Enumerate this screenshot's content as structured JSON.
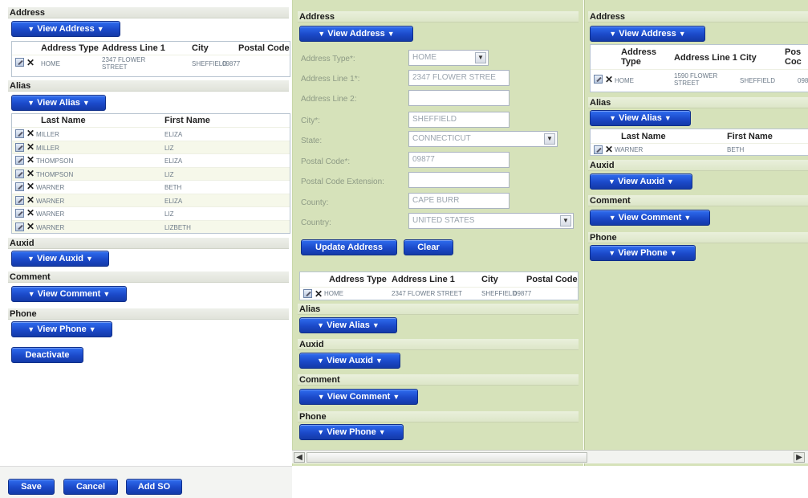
{
  "left": {
    "address": {
      "title": "Address",
      "view_button": "View Address",
      "columns": [
        "Address Type",
        "Address Line 1",
        "City",
        "Postal Code"
      ],
      "rows": [
        {
          "type": "HOME",
          "line1": "2347 FLOWER STREET",
          "city": "SHEFFIELD",
          "postal": "09877"
        }
      ]
    },
    "alias": {
      "title": "Alias",
      "view_button": "View Alias",
      "columns": [
        "Last Name",
        "First Name"
      ],
      "rows": [
        {
          "last": "MILLER",
          "first": "ELIZA"
        },
        {
          "last": "MILLER",
          "first": "LIZ"
        },
        {
          "last": "THOMPSON",
          "first": "ELIZA"
        },
        {
          "last": "THOMPSON",
          "first": "LIZ"
        },
        {
          "last": "WARNER",
          "first": "BETH"
        },
        {
          "last": "WARNER",
          "first": "ELIZA"
        },
        {
          "last": "WARNER",
          "first": "LIZ"
        },
        {
          "last": "WARNER",
          "first": "LIZBETH"
        }
      ]
    },
    "auxid": {
      "title": "Auxid",
      "view_button": "View Auxid"
    },
    "comment": {
      "title": "Comment",
      "view_button": "View Comment"
    },
    "phone": {
      "title": "Phone",
      "view_button": "View Phone"
    },
    "deactivate_button": "Deactivate"
  },
  "bottom": {
    "save": "Save",
    "cancel": "Cancel",
    "add_so": "Add SO"
  },
  "middle": {
    "address": {
      "title": "Address",
      "view_button": "View Address",
      "form": {
        "address_type_label": "Address Type*:",
        "address_type_value": "HOME",
        "line1_label": "Address Line 1*:",
        "line1_value": "2347 FLOWER STREE",
        "line2_label": "Address Line 2:",
        "line2_value": "",
        "city_label": "City*:",
        "city_value": "SHEFFIELD",
        "state_label": "State:",
        "state_value": "CONNECTICUT",
        "postal_label": "Postal Code*:",
        "postal_value": "09877",
        "postal_ext_label": "Postal Code Extension:",
        "postal_ext_value": "",
        "county_label": "County:",
        "county_value": "CAPE BURR",
        "country_label": "Country:",
        "country_value": "UNITED STATES"
      },
      "update_button": "Update Address",
      "clear_button": "Clear",
      "columns": [
        "Address Type",
        "Address Line 1",
        "City",
        "Postal Code"
      ],
      "rows": [
        {
          "type": "HOME",
          "line1": "2347 FLOWER STREET",
          "city": "SHEFFIELD",
          "postal": "09877"
        }
      ]
    },
    "alias": {
      "title": "Alias",
      "view_button": "View Alias"
    },
    "auxid": {
      "title": "Auxid",
      "view_button": "View Auxid"
    },
    "comment": {
      "title": "Comment",
      "view_button": "View Comment"
    },
    "phone": {
      "title": "Phone",
      "view_button": "View Phone"
    }
  },
  "right": {
    "address": {
      "title": "Address",
      "view_button": "View Address",
      "columns": [
        "Address Type",
        "Address Line 1",
        "City",
        "Pos Coc"
      ],
      "rows": [
        {
          "type": "HOME",
          "line1": "1590 FLOWER STREET",
          "city": "SHEFFIELD",
          "postal": "098"
        }
      ]
    },
    "alias": {
      "title": "Alias",
      "view_button": "View Alias",
      "columns": [
        "Last Name",
        "First Name"
      ],
      "rows": [
        {
          "last": "WARNER",
          "first": "BETH"
        }
      ]
    },
    "auxid": {
      "title": "Auxid",
      "view_button": "View Auxid"
    },
    "comment": {
      "title": "Comment",
      "view_button": "View Comment"
    },
    "phone": {
      "title": "Phone",
      "view_button": "View Phone"
    }
  },
  "icons": {
    "edit": "edit-icon",
    "delete": "delete-x-icon",
    "dropdown": "chevron-down-icon",
    "scroll_left": "arrow-left-icon",
    "scroll_right": "arrow-right-icon"
  },
  "colors": {
    "button": "#1b49c9",
    "pane_green": "#d6e2ba"
  }
}
